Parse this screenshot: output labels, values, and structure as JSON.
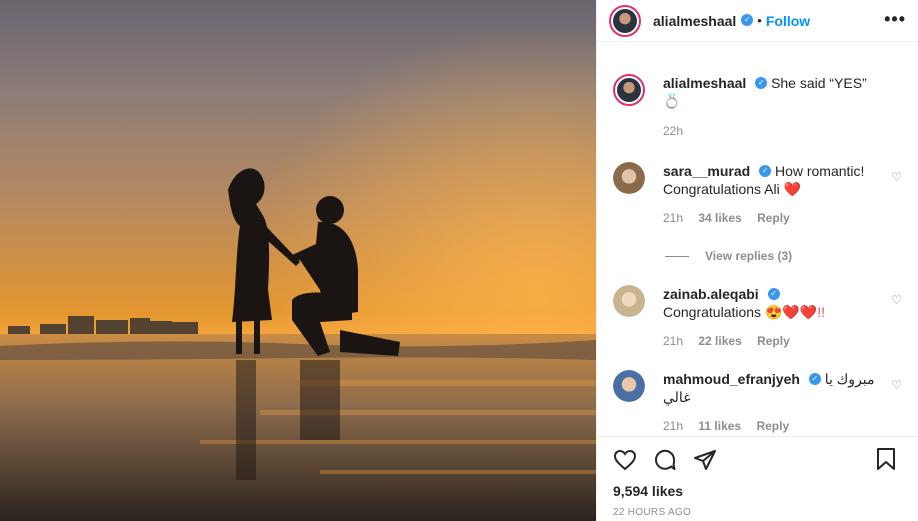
{
  "post": {
    "username": "alialmeshaal",
    "follow_label": "Follow",
    "dot": "•",
    "more_label": "•••"
  },
  "caption": {
    "username": "alialmeshaal",
    "text": "She said “YES” 💍",
    "time": "22h"
  },
  "comments": [
    {
      "username": "sara__murad",
      "text": "How romantic! Congratulations Ali",
      "emoji": "❤️",
      "time": "21h",
      "likes": "34 likes",
      "reply": "Reply",
      "avatar_color": "#b38b6d"
    },
    {
      "username": "zainab.aleqabi",
      "text": "Congratulations",
      "emoji": "😍❤️❤️!!",
      "time": "21h",
      "likes": "22 likes",
      "reply": "Reply",
      "avatar_color": "#d8c9a8"
    },
    {
      "username": "mahmoud_efranjyeh",
      "text": "مبروك يا غالي",
      "time": "21h",
      "likes": "11 likes",
      "reply": "Reply",
      "avatar_color": "#4a6fa5"
    }
  ],
  "view_replies": "View replies (3)",
  "footer": {
    "likes": "9,594 likes",
    "ago": "22 HOURS AGO"
  },
  "icons": {
    "like": "heart-icon",
    "comment": "comment-icon",
    "share": "share-icon",
    "save": "bookmark-icon",
    "verified": "verified-badge-icon"
  },
  "colors": {
    "follow": "#0095f6",
    "verified": "#3897f0",
    "heart": "#ed4956"
  }
}
